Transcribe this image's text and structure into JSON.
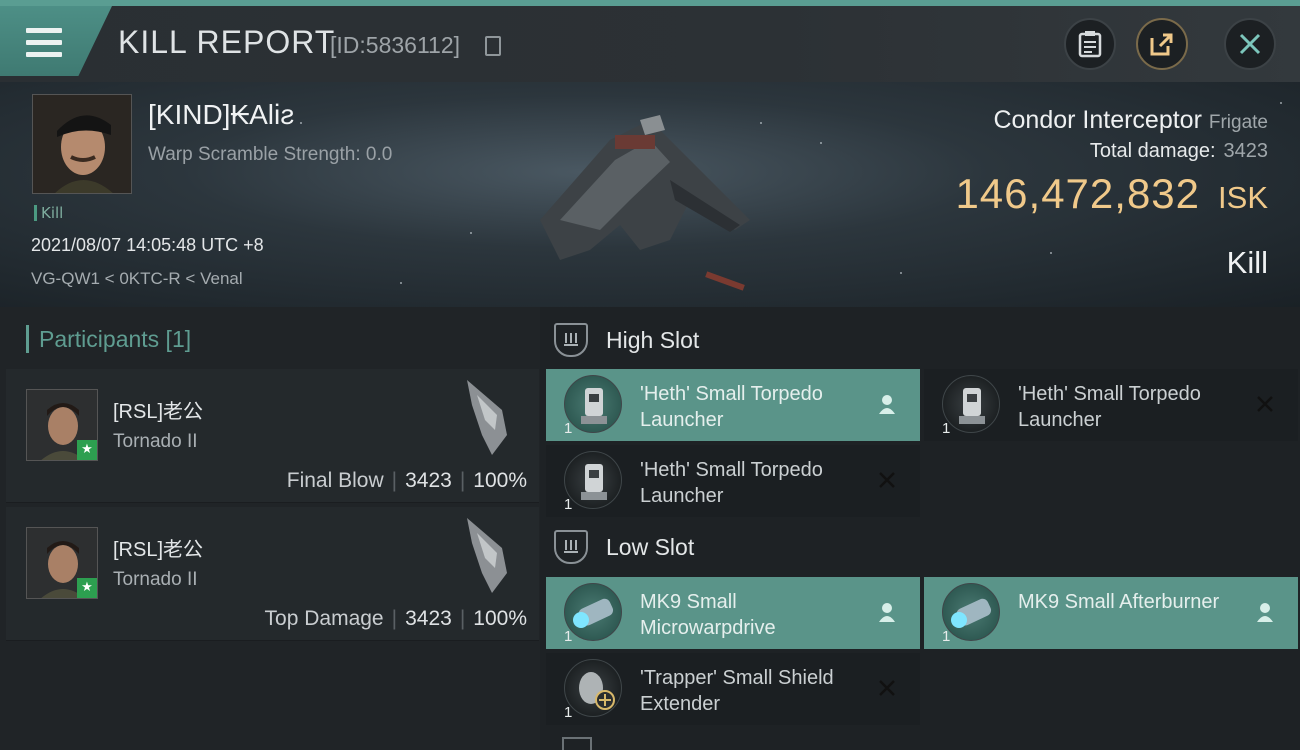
{
  "header": {
    "title": "KILL REPORT",
    "id_label": "[ID:5836112]",
    "buttons": [
      "clipboard-icon",
      "share-icon",
      "close-icon"
    ]
  },
  "victim": {
    "pilot": "[KIND]₭Alіƨ",
    "warp_scramble": "Warp Scramble Strength: 0.0",
    "tag": "Kill",
    "datetime": "2021/08/07 14:05:48 UTC +8",
    "location": "VG-QW1 < 0KTC-R < Venal",
    "ship_name": "Condor Interceptor",
    "ship_class": "Frigate",
    "total_damage_label": "Total damage:",
    "total_damage": "3423",
    "isk_value": "146,472,832",
    "isk_unit": "ISK",
    "result": "Kill"
  },
  "participants": {
    "heading": "Participants [1]",
    "items": [
      {
        "name": "[RSL]老公",
        "ship": "Tornado II",
        "role": "Final Blow",
        "damage": "3423",
        "percent": "100%"
      },
      {
        "name": "[RSL]老公",
        "ship": "Tornado II",
        "role": "Top Damage",
        "damage": "3423",
        "percent": "100%"
      }
    ]
  },
  "slots": {
    "high": {
      "label": "High Slot",
      "modules": [
        {
          "name": "'Heth' Small Torpedo Launcher",
          "qty": "1",
          "status": "dropped"
        },
        {
          "name": "'Heth' Small Torpedo Launcher",
          "qty": "1",
          "status": "destroyed"
        },
        {
          "name": "'Heth' Small Torpedo Launcher",
          "qty": "1",
          "status": "destroyed"
        }
      ]
    },
    "low": {
      "label": "Low Slot",
      "modules": [
        {
          "name": "MK9 Small Microwarpdrive",
          "qty": "1",
          "status": "dropped"
        },
        {
          "name": "MK9 Small Afterburner",
          "qty": "1",
          "status": "dropped"
        },
        {
          "name": "'Trapper' Small Shield Extender",
          "qty": "1",
          "status": "destroyed"
        }
      ]
    }
  },
  "colors": {
    "accent": "#5a9489",
    "isk": "#f0c98a",
    "dropped_bg": "#5a9489"
  }
}
